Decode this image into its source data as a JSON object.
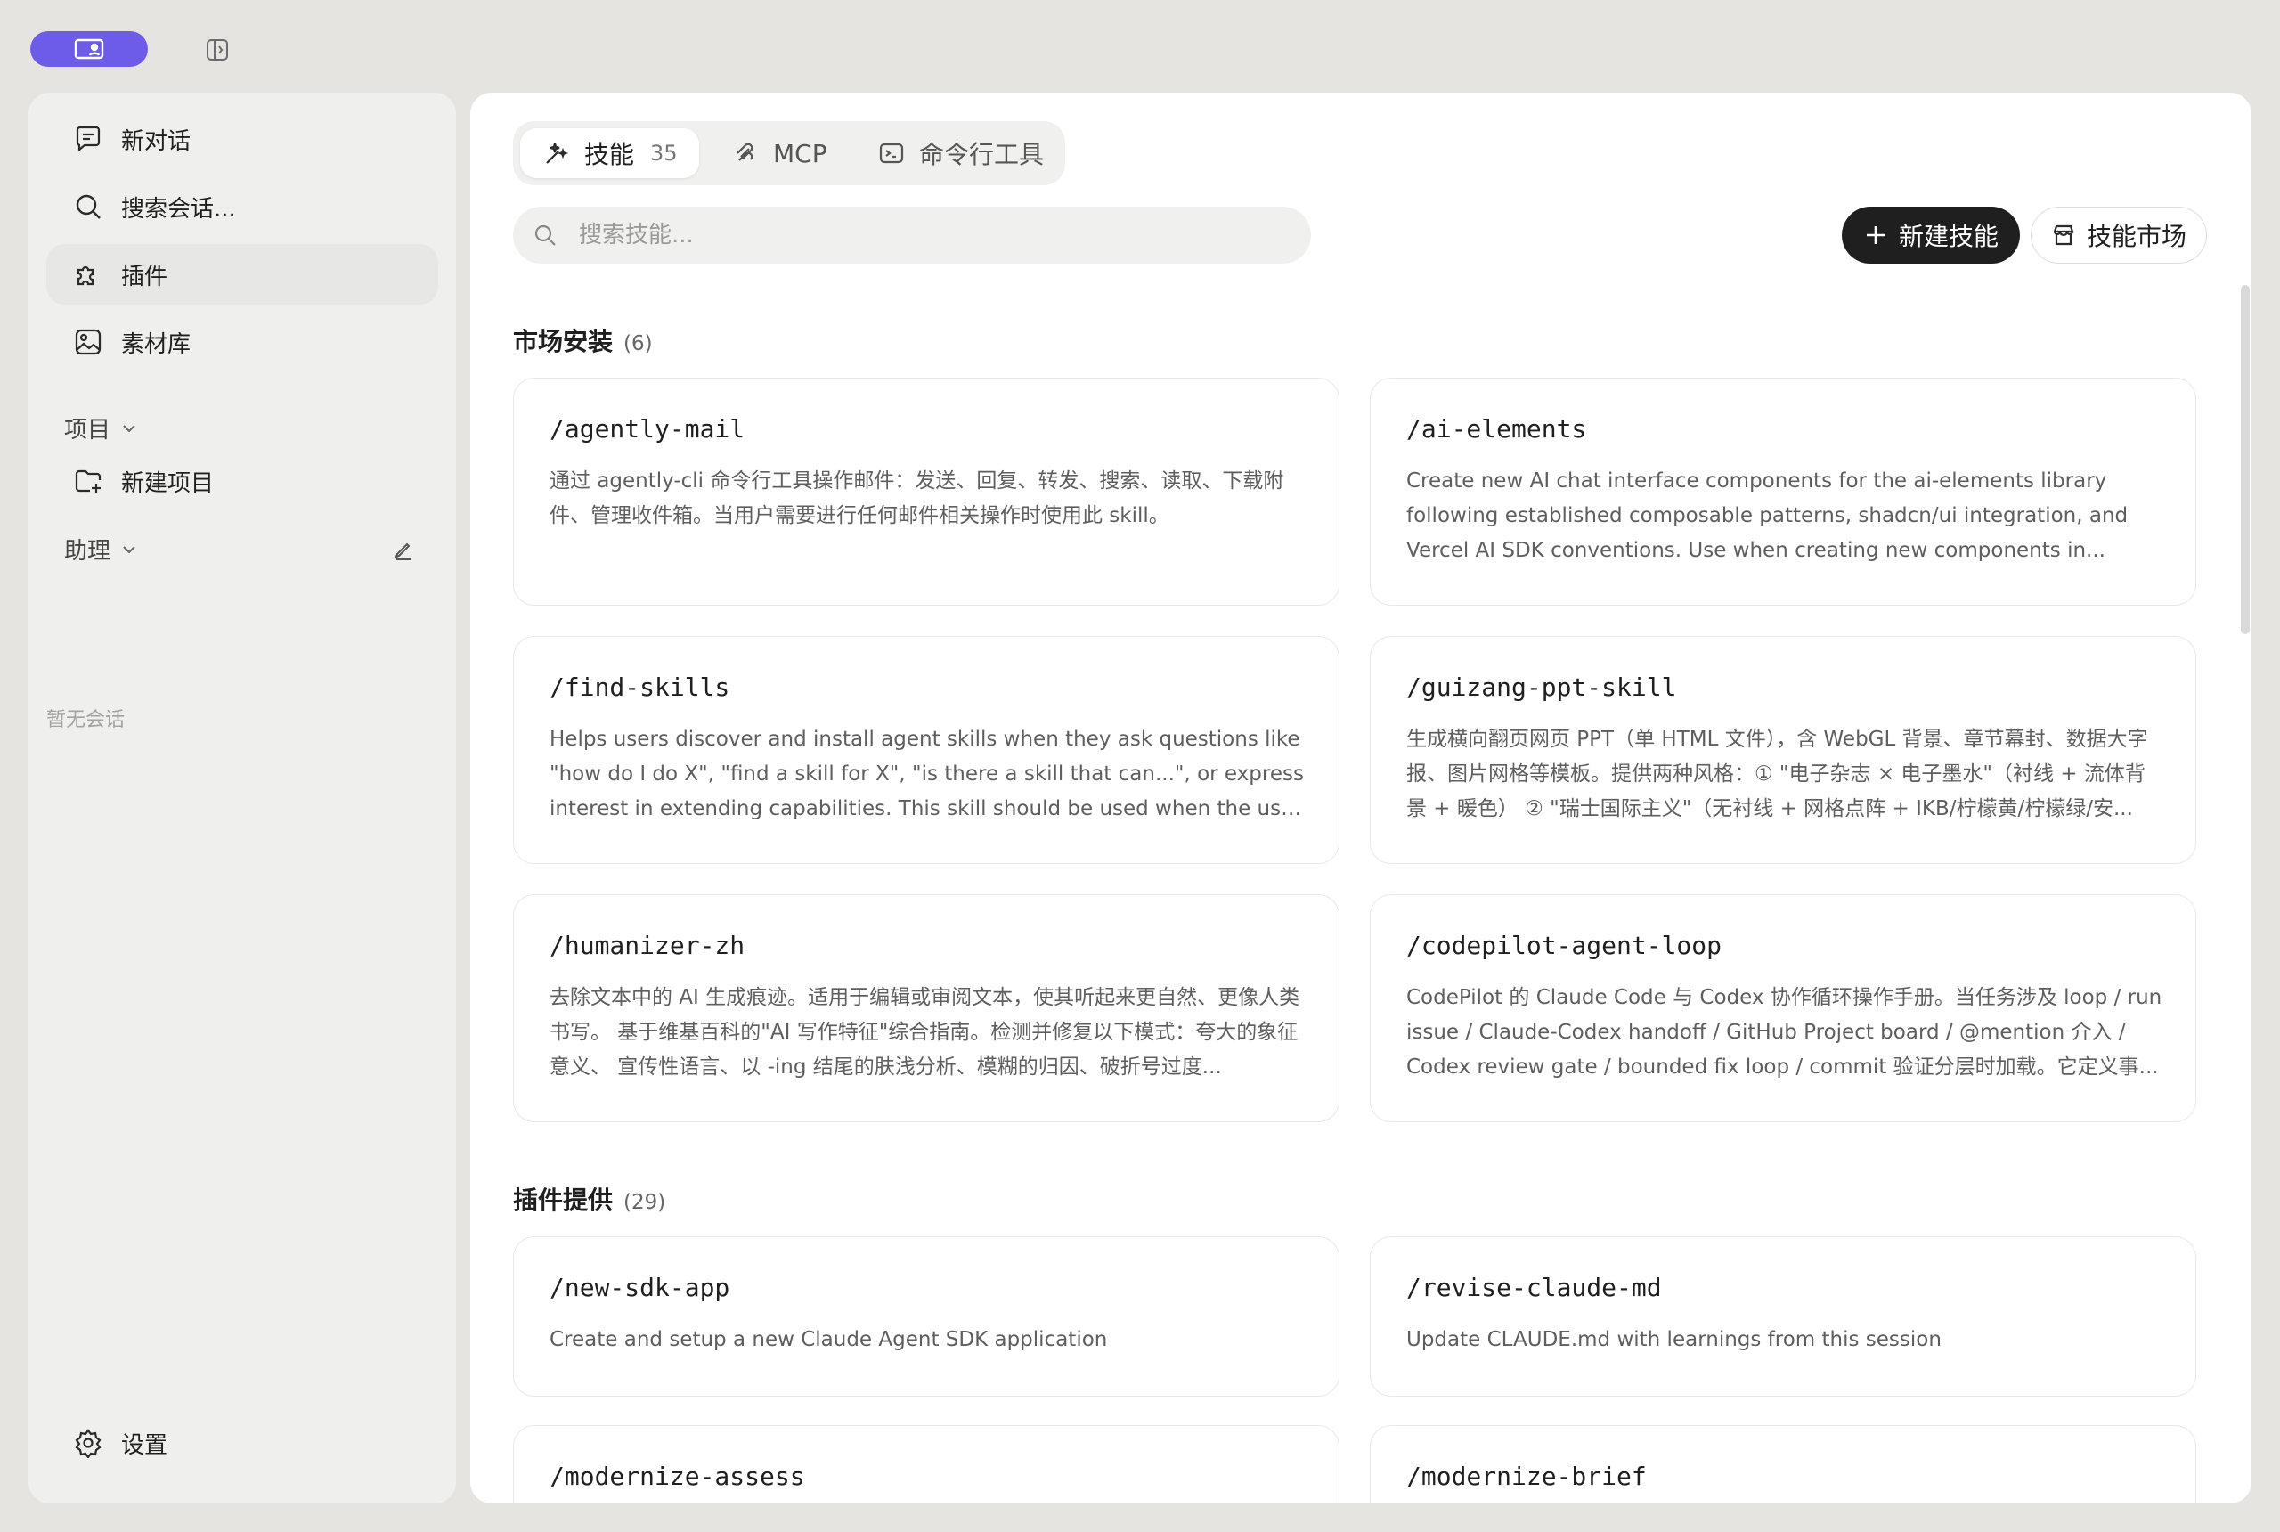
{
  "sidebar": {
    "new_chat": "新对话",
    "search": "搜索会话...",
    "plugins": "插件",
    "library": "素材库",
    "projects_label": "项目",
    "new_project": "新建项目",
    "assistant_label": "助理",
    "empty": "暂无会话",
    "settings": "设置"
  },
  "tabs": [
    {
      "label": "技能",
      "count": "35",
      "icon": "wand-icon"
    },
    {
      "label": "MCP",
      "icon": "mcp-icon"
    },
    {
      "label": "命令行工具",
      "icon": "terminal-icon"
    }
  ],
  "search": {
    "placeholder": "搜索技能..."
  },
  "actions": {
    "new_skill": "新建技能",
    "market": "技能市场"
  },
  "sections": [
    {
      "title": "市场安装",
      "count": "(6)",
      "cards": [
        {
          "name": "/agently-mail",
          "desc": "通过 agently-cli 命令行工具操作邮件：发送、回复、转发、搜索、读取、下载附件、管理收件箱。当用户需要进行任何邮件相关操作时使用此 skill。"
        },
        {
          "name": "/ai-elements",
          "desc": "Create new AI chat interface components for the ai-elements library following established composable patterns, shadcn/ui integration, and Vercel AI SDK conventions. Use when creating new components in..."
        },
        {
          "name": "/find-skills",
          "desc": "Helps users discover and install agent skills when they ask questions like \"how do I do X\", \"find a skill for X\", \"is there a skill that can...\", or express interest in extending capabilities. This skill should be used when the user is..."
        },
        {
          "name": "/guizang-ppt-skill",
          "desc": "生成横向翻页网页 PPT（单 HTML 文件），含 WebGL 背景、章节幕封、数据大字报、图片网格等模板。提供两种风格：① \"电子杂志 × 电子墨水\"（衬线 + 流体背景 + 暖色） ② \"瑞士国际主义\"（无衬线 + 网格点阵 + IKB/柠檬黄/柠檬绿/安..."
        },
        {
          "name": "/humanizer-zh",
          "desc": "去除文本中的 AI 生成痕迹。适用于编辑或审阅文本，使其听起来更自然、更像人类书写。 基于维基百科的\"AI 写作特征\"综合指南。检测并修复以下模式：夸大的象征意义、 宣传性语言、以 -ing 结尾的肤浅分析、模糊的归因、破折号过度..."
        },
        {
          "name": "/codepilot-agent-loop",
          "desc": "CodePilot 的 Claude Code 与 Codex 协作循环操作手册。当任务涉及 loop / run issue / Claude-Codex handoff / GitHub Project board / @mention 介入 / Codex review gate / bounded fix loop / commit 验证分层时加载。它定义事..."
        }
      ]
    },
    {
      "title": "插件提供",
      "count": "(29)",
      "cards": [
        {
          "name": "/new-sdk-app",
          "desc": "Create and setup a new Claude Agent SDK application"
        },
        {
          "name": "/revise-claude-md",
          "desc": "Update CLAUDE.md with learnings from this session"
        },
        {
          "name": "/modernize-assess",
          "desc": ""
        },
        {
          "name": "/modernize-brief",
          "desc": ""
        }
      ]
    }
  ],
  "colors": {
    "accent": "#6c5ce7",
    "primary_button": "#1f1f1f"
  }
}
